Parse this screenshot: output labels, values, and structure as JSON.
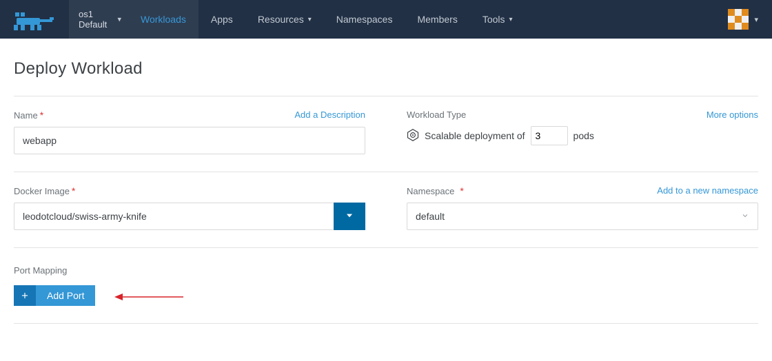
{
  "nav": {
    "cluster_name": "os1",
    "cluster_scope": "Default",
    "items": [
      {
        "label": "Workloads",
        "active": true,
        "has_chev": false
      },
      {
        "label": "Apps",
        "active": false,
        "has_chev": false
      },
      {
        "label": "Resources",
        "active": false,
        "has_chev": true
      },
      {
        "label": "Namespaces",
        "active": false,
        "has_chev": false
      },
      {
        "label": "Members",
        "active": false,
        "has_chev": false
      },
      {
        "label": "Tools",
        "active": false,
        "has_chev": true
      }
    ]
  },
  "page": {
    "title": "Deploy Workload"
  },
  "form": {
    "name_label": "Name",
    "name_value": "webapp",
    "add_description_link": "Add a Description",
    "workload_type_label": "Workload Type",
    "more_options_link": "More options",
    "scalable_prefix": "Scalable deployment of",
    "pods_value": "3",
    "scalable_suffix": "pods",
    "docker_image_label": "Docker Image",
    "docker_image_value": "leodotcloud/swiss-army-knife",
    "namespace_label": "Namespace",
    "add_namespace_link": "Add to a new namespace",
    "namespace_value": "default",
    "port_mapping_label": "Port Mapping",
    "add_port_label": "Add Port"
  },
  "icons": {
    "k8s": "kubernetes-icon"
  }
}
